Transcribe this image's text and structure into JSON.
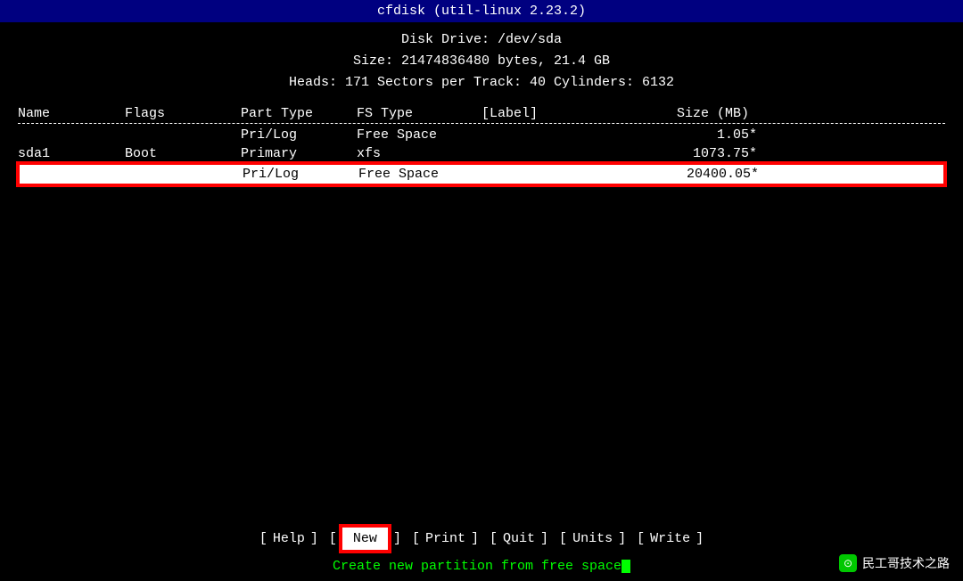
{
  "topbar": {
    "title": "cfdisk (util-linux 2.23.2)"
  },
  "header": {
    "line1": "Disk Drive: /dev/sda",
    "line2": "Size: 21474836480 bytes, 21.4 GB",
    "line3": "Heads: 171   Sectors per Track: 40   Cylinders: 6132"
  },
  "table": {
    "columns": {
      "name": "Name",
      "flags": "Flags",
      "parttype": "Part Type",
      "fstype": "FS Type",
      "label": "[Label]",
      "size": "Size (MB)"
    },
    "rows": [
      {
        "name": "",
        "flags": "",
        "parttype": "Pri/Log",
        "fstype": "Free Space",
        "label": "",
        "size": "1.05",
        "star": "*",
        "highlighted": false
      },
      {
        "name": "sda1",
        "flags": "Boot",
        "parttype": "Primary",
        "fstype": "xfs",
        "label": "",
        "size": "1073.75",
        "star": "*",
        "highlighted": false
      },
      {
        "name": "",
        "flags": "",
        "parttype": "Pri/Log",
        "fstype": "Free Space",
        "label": "",
        "size": "20400.05",
        "star": "*",
        "highlighted": true
      }
    ]
  },
  "menu": {
    "items": [
      {
        "label": "Help",
        "active": false
      },
      {
        "label": "New",
        "active": true
      },
      {
        "label": "Print",
        "active": false
      },
      {
        "label": "Quit",
        "active": false
      },
      {
        "label": "Units",
        "active": false
      },
      {
        "label": "Write",
        "active": false
      }
    ]
  },
  "status": {
    "text": "Create new partition from free space"
  },
  "watermark": {
    "text": "民工哥技术之路"
  }
}
